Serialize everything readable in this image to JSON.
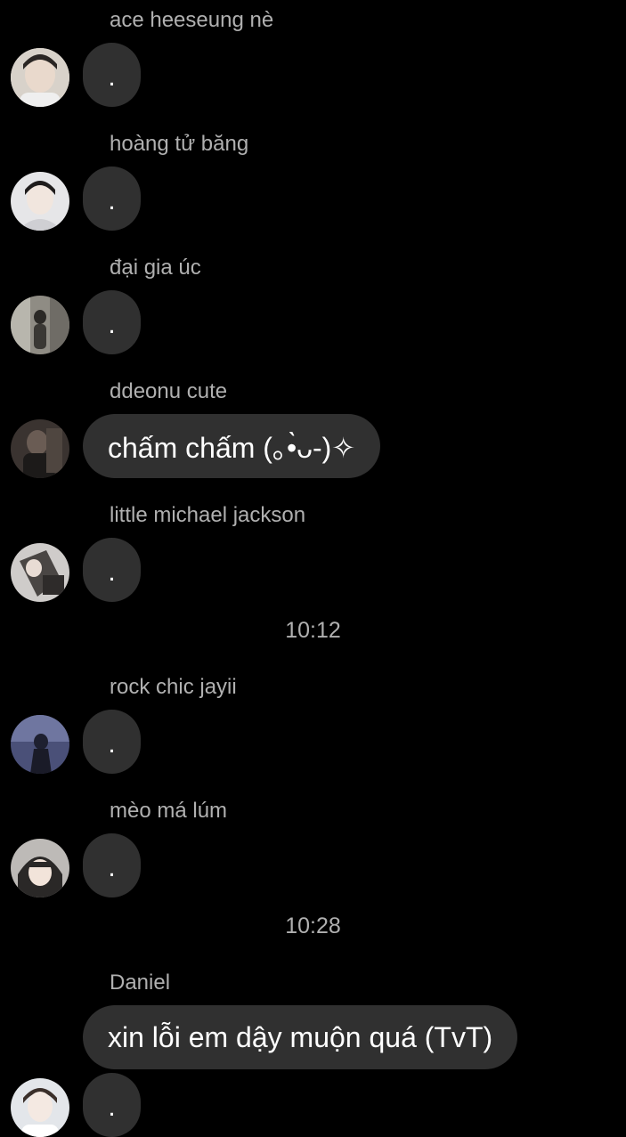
{
  "messages": [
    {
      "sender": "ace heeseung nè",
      "text": ".",
      "avatar_icon": "user-avatar-icon"
    },
    {
      "sender": "hoàng tử băng",
      "text": ".",
      "avatar_icon": "user-avatar-icon"
    },
    {
      "sender": "đại gia úc",
      "text": ".",
      "avatar_icon": "user-avatar-icon"
    },
    {
      "sender": "ddeonu cute",
      "text": "chấm chấm (｡•̀ᴗ-)✧",
      "avatar_icon": "user-avatar-icon"
    },
    {
      "sender": "little michael jackson",
      "text": ".",
      "avatar_icon": "user-avatar-icon"
    },
    {
      "sender": "rock chic jayii",
      "text": ".",
      "avatar_icon": "user-avatar-icon"
    },
    {
      "sender": "mèo má lúm",
      "text": ".",
      "avatar_icon": "user-avatar-icon"
    },
    {
      "sender": "Daniel",
      "text": "xin lỗi em dậy muộn quá (TvT)",
      "avatar_icon": "user-avatar-icon"
    },
    {
      "sender": "",
      "text": ".",
      "avatar_icon": "user-avatar-icon"
    }
  ],
  "timestamps": [
    "10:12",
    "10:28"
  ],
  "colors": {
    "background": "#000000",
    "bubble": "#303030",
    "sender_text": "#b0b0b0",
    "message_text": "#ffffff"
  }
}
